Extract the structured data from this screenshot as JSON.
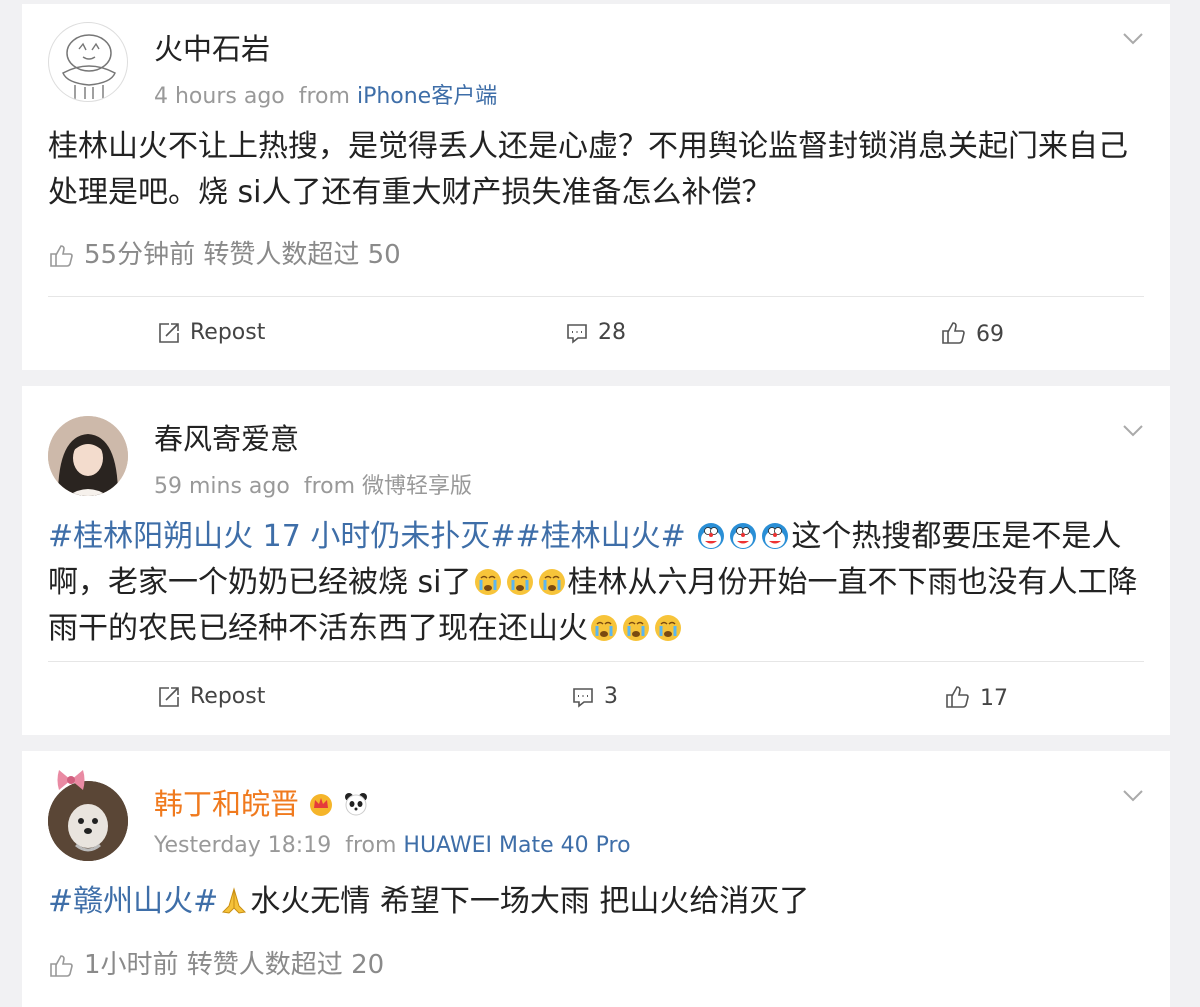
{
  "comments": [
    {
      "username": "火中石岩",
      "time": "4 hours ago",
      "from_label": "from",
      "source": "iPhone客户端",
      "text": "桂林山火不让上热搜，是觉得丢人还是心虚？不用舆论监督封锁消息关起门来自己处理是吧。烧 si人了还有重大财产损失准备怎么补偿？",
      "like_note": "55分钟前 转赞人数超过 50",
      "repost_label": "Repost",
      "comment_count": "28",
      "like_count": "69"
    },
    {
      "username": "春风寄爱意",
      "time": "59 mins ago",
      "from_label": "from",
      "source": "微博轻享版",
      "hashtag1": "#桂林阳朔山火 17 小时仍未扑灭#",
      "hashtag2": "#桂林山火#",
      "text_a": "这个热搜都要压是不是人啊，老家一个奶奶已经被烧 si了",
      "text_b": "桂林从六月份开始一直不下雨也没有人工降雨干的农民已经种不活东西了现在还山火",
      "repost_label": "Repost",
      "comment_count": "3",
      "like_count": "17"
    },
    {
      "username": "韩丁和皖晋",
      "username_color": "#f07a1e",
      "time": "Yesterday 18:19",
      "from_label": "from",
      "source": "HUAWEI Mate 40 Pro",
      "hashtag": "#赣州山火#",
      "text": "水火无情 希望下一场大雨 把山火给消灭了",
      "like_note": "1小时前 转赞人数超过 20"
    }
  ],
  "icons": {
    "chevron": "chevron-down-icon",
    "thumb": "thumbs-up-icon",
    "repost": "repost-icon",
    "comment": "comment-icon"
  },
  "colors": {
    "link": "#3e6ea8",
    "meta": "#999999",
    "vip_name": "#f07a1e",
    "background": "#f1f1f3"
  }
}
